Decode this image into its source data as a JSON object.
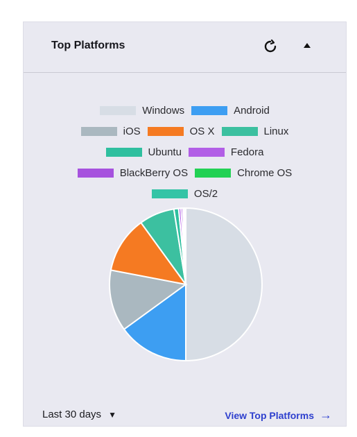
{
  "card": {
    "title": "Top Platforms"
  },
  "header": {
    "refresh_icon": "refresh-icon",
    "collapse_icon": "collapse-up-icon"
  },
  "legend": [
    {
      "label": "Windows",
      "color": "#d7dde5"
    },
    {
      "label": "Android",
      "color": "#3d9ef2"
    },
    {
      "label": "iOS",
      "color": "#aab8c0"
    },
    {
      "label": "OS X",
      "color": "#f57a22"
    },
    {
      "label": "Linux",
      "color": "#3cc0a0"
    },
    {
      "label": "Ubuntu",
      "color": "#2fbf9f"
    },
    {
      "label": "Fedora",
      "color": "#b25fe6"
    },
    {
      "label": "BlackBerry OS",
      "color": "#a652de"
    },
    {
      "label": "Chrome OS",
      "color": "#22d154"
    },
    {
      "label": "OS/2",
      "color": "#34c4a6"
    }
  ],
  "chart_data": {
    "type": "pie",
    "categories": [
      "Windows",
      "Android",
      "iOS",
      "OS X",
      "Linux",
      "Ubuntu",
      "Fedora",
      "BlackBerry OS",
      "Chrome OS",
      "OS/2"
    ],
    "values": [
      50,
      15,
      13,
      12,
      7.5,
      1,
      0.5,
      0.4,
      0.3,
      0.3
    ],
    "colors": [
      "#d7dde5",
      "#3d9ef2",
      "#aab8c0",
      "#f57a22",
      "#3cc0a0",
      "#2fbf9f",
      "#b25fe6",
      "#a652de",
      "#22d154",
      "#34c4a6"
    ]
  },
  "footer": {
    "range_label": "Last 30 days",
    "view_link": "View Top Platforms"
  }
}
